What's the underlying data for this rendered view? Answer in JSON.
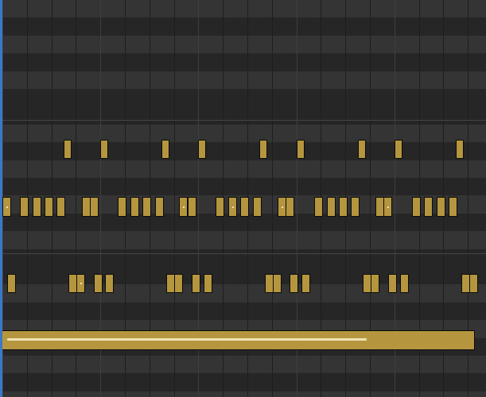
{
  "piano_roll": {
    "colors": {
      "lane_light": "#343434",
      "lane_dark": "#262626",
      "note_fill": "#b5963f",
      "note_border": "#0b0b0b",
      "velocity_bar": "#f1e3b6",
      "playhead_edge": "#3a78c8"
    },
    "icons": {}
  }
}
